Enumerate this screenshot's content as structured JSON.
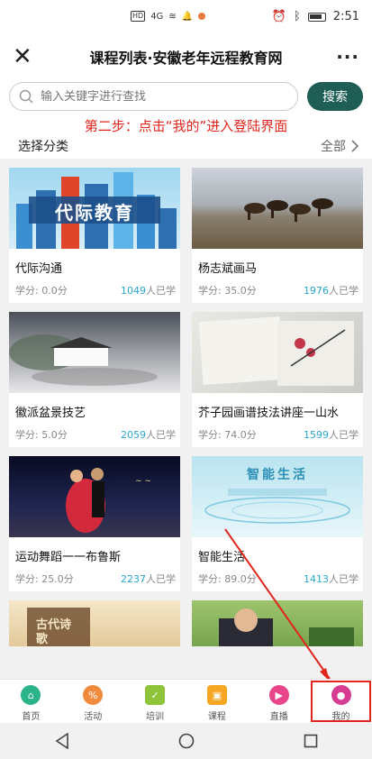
{
  "status": {
    "time": "2:51",
    "net": "HD",
    "sig": "4G"
  },
  "header": {
    "close_icon": "close-icon",
    "title": "课程列表·安徽老年远程教育网",
    "more": "···"
  },
  "search": {
    "placeholder": "输入关键字进行查找",
    "button": "搜索"
  },
  "annotation": "第二步：点击“我的”进入登陆界面",
  "category": {
    "label": "选择分类",
    "all": "全部"
  },
  "courses": [
    {
      "name": "代际沟通",
      "credit_label": "学分:",
      "credit": "0.0分",
      "count": "1049",
      "count_unit": "人已学",
      "thumb_text": "代际教育"
    },
    {
      "name": "杨志斌画马",
      "credit_label": "学分:",
      "credit": "35.0分",
      "count": "1976",
      "count_unit": "人已学"
    },
    {
      "name": "徽派盆景技艺",
      "credit_label": "学分:",
      "credit": "5.0分",
      "count": "2059",
      "count_unit": "人已学"
    },
    {
      "name": "芥子园画谱技法讲座一山水",
      "credit_label": "学分:",
      "credit": "74.0分",
      "count": "1599",
      "count_unit": "人已学"
    },
    {
      "name": "运动舞蹈一一布鲁斯",
      "credit_label": "学分:",
      "credit": "25.0分",
      "count": "2237",
      "count_unit": "人已学"
    },
    {
      "name": "智能生活",
      "credit_label": "学分:",
      "credit": "89.0分",
      "count": "1413",
      "count_unit": "人已学",
      "thumb_text": "智能生活"
    },
    {
      "name": "",
      "credit_label": "",
      "credit": "",
      "count": "",
      "count_unit": "",
      "thumb_text": "古代诗歌"
    },
    {
      "name": "",
      "credit_label": "",
      "credit": "",
      "count": "",
      "count_unit": ""
    }
  ],
  "tabs": [
    {
      "label": "首页",
      "icon": "home-icon",
      "color": "#2bb38a"
    },
    {
      "label": "活动",
      "icon": "activity-icon",
      "color": "#f08a3c"
    },
    {
      "label": "培训",
      "icon": "training-icon",
      "color": "#8fc43a"
    },
    {
      "label": "课程",
      "icon": "course-icon",
      "color": "#f5a623"
    },
    {
      "label": "直播",
      "icon": "live-icon",
      "color": "#e8458b"
    },
    {
      "label": "我的",
      "icon": "user-icon",
      "color": "#d63c8f"
    }
  ],
  "colors": {
    "accent": "#1f5e55",
    "annotation": "#e0261c",
    "count": "#28a8cf"
  }
}
